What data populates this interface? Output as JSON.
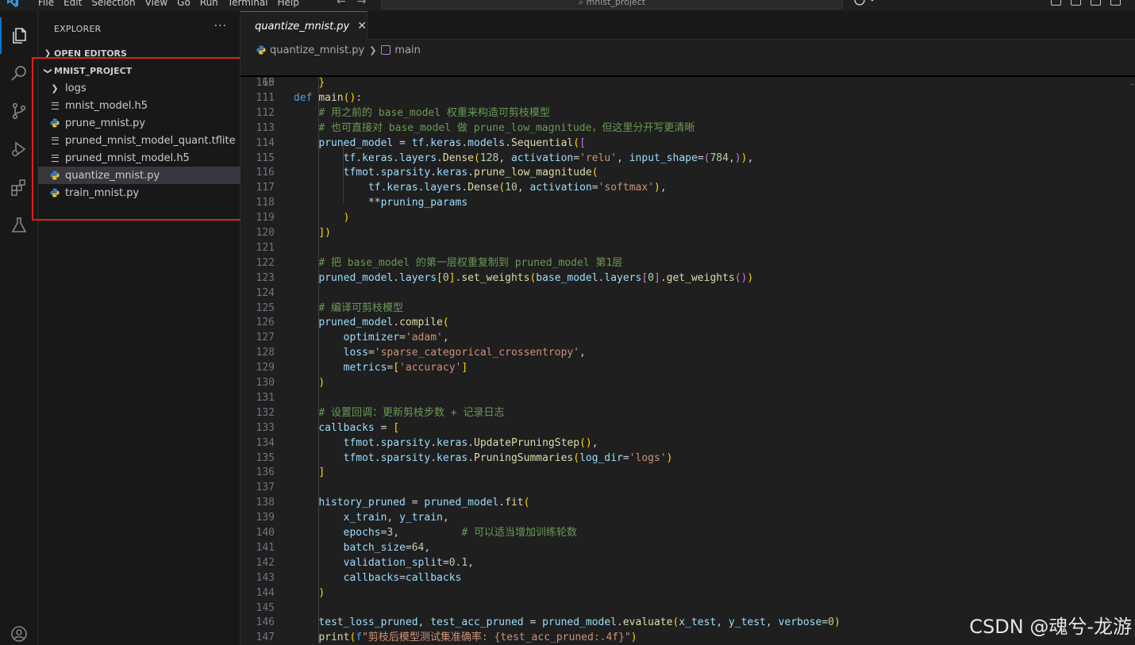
{
  "titlebar": {
    "menu": [
      "File",
      "Edit",
      "Selection",
      "View",
      "Go",
      "Run",
      "Terminal",
      "Help"
    ],
    "search_text": "mnist_project"
  },
  "sidebar": {
    "title": "EXPLORER",
    "open_editors_label": "OPEN EDITORS",
    "project_label": "MNIST_PROJECT",
    "items": [
      {
        "label": "logs",
        "icon": "folder-chevron-icon",
        "selected": false
      },
      {
        "label": "mnist_model.h5",
        "icon": "file-lines-icon",
        "selected": false
      },
      {
        "label": "prune_mnist.py",
        "icon": "python-icon",
        "selected": false
      },
      {
        "label": "pruned_mnist_model_quant.tflite",
        "icon": "file-lines-icon",
        "selected": false
      },
      {
        "label": "pruned_mnist_model.h5",
        "icon": "file-lines-icon",
        "selected": false
      },
      {
        "label": "quantize_mnist.py",
        "icon": "python-icon",
        "selected": true
      },
      {
        "label": "train_mnist.py",
        "icon": "python-icon",
        "selected": false
      }
    ]
  },
  "editor": {
    "tab_label": "quantize_mnist.py",
    "breadcrumb": {
      "file": "quantize_mnist.py",
      "symbol": "main"
    },
    "sticky": {
      "line_number": "65",
      "text": "def main():"
    },
    "lines": [
      {
        "n": "110",
        "text": "    }"
      },
      {
        "n": "111",
        "text": ""
      },
      {
        "n": "112",
        "text": "    # 用之前的 base_model 权重来构造可剪枝模型"
      },
      {
        "n": "113",
        "text": "    # 也可直接对 base_model 做 prune_low_magnitude，但这里分开写更清晰"
      },
      {
        "n": "114",
        "text": "    pruned_model = tf.keras.models.Sequential(["
      },
      {
        "n": "115",
        "text": "        tf.keras.layers.Dense(128, activation='relu', input_shape=(784,)),"
      },
      {
        "n": "116",
        "text": "        tfmot.sparsity.keras.prune_low_magnitude("
      },
      {
        "n": "117",
        "text": "            tf.keras.layers.Dense(10, activation='softmax'),"
      },
      {
        "n": "118",
        "text": "            **pruning_params"
      },
      {
        "n": "119",
        "text": "        )"
      },
      {
        "n": "120",
        "text": "    ])"
      },
      {
        "n": "121",
        "text": ""
      },
      {
        "n": "122",
        "text": "    # 把 base_model 的第一层权重复制到 pruned_model 第1层"
      },
      {
        "n": "123",
        "text": "    pruned_model.layers[0].set_weights(base_model.layers[0].get_weights())"
      },
      {
        "n": "124",
        "text": ""
      },
      {
        "n": "125",
        "text": "    # 编译可剪枝模型"
      },
      {
        "n": "126",
        "text": "    pruned_model.compile("
      },
      {
        "n": "127",
        "text": "        optimizer='adam',"
      },
      {
        "n": "128",
        "text": "        loss='sparse_categorical_crossentropy',"
      },
      {
        "n": "129",
        "text": "        metrics=['accuracy']"
      },
      {
        "n": "130",
        "text": "    )"
      },
      {
        "n": "131",
        "text": ""
      },
      {
        "n": "132",
        "text": "    # 设置回调：更新剪枝步数 + 记录日志"
      },
      {
        "n": "133",
        "text": "    callbacks = ["
      },
      {
        "n": "134",
        "text": "        tfmot.sparsity.keras.UpdatePruningStep(),"
      },
      {
        "n": "135",
        "text": "        tfmot.sparsity.keras.PruningSummaries(log_dir='logs')"
      },
      {
        "n": "136",
        "text": "    ]"
      },
      {
        "n": "137",
        "text": ""
      },
      {
        "n": "138",
        "text": "    history_pruned = pruned_model.fit("
      },
      {
        "n": "139",
        "text": "        x_train, y_train,"
      },
      {
        "n": "140",
        "text": "        epochs=3,          # 可以适当增加训练轮数"
      },
      {
        "n": "141",
        "text": "        batch_size=64,"
      },
      {
        "n": "142",
        "text": "        validation_split=0.1,"
      },
      {
        "n": "143",
        "text": "        callbacks=callbacks"
      },
      {
        "n": "144",
        "text": "    )"
      },
      {
        "n": "145",
        "text": ""
      },
      {
        "n": "146",
        "text": "    test_loss_pruned, test_acc_pruned = pruned_model.evaluate(x_test, y_test, verbose=0)"
      },
      {
        "n": "147",
        "text": "    print(f\"剪枝后模型测试集准确率: {test_acc_pruned:.4f}\")"
      }
    ]
  },
  "watermark": "CSDN @魂兮-龙游",
  "colors": {
    "accent": "#0078d4",
    "highlight_box": "#e0201d"
  }
}
